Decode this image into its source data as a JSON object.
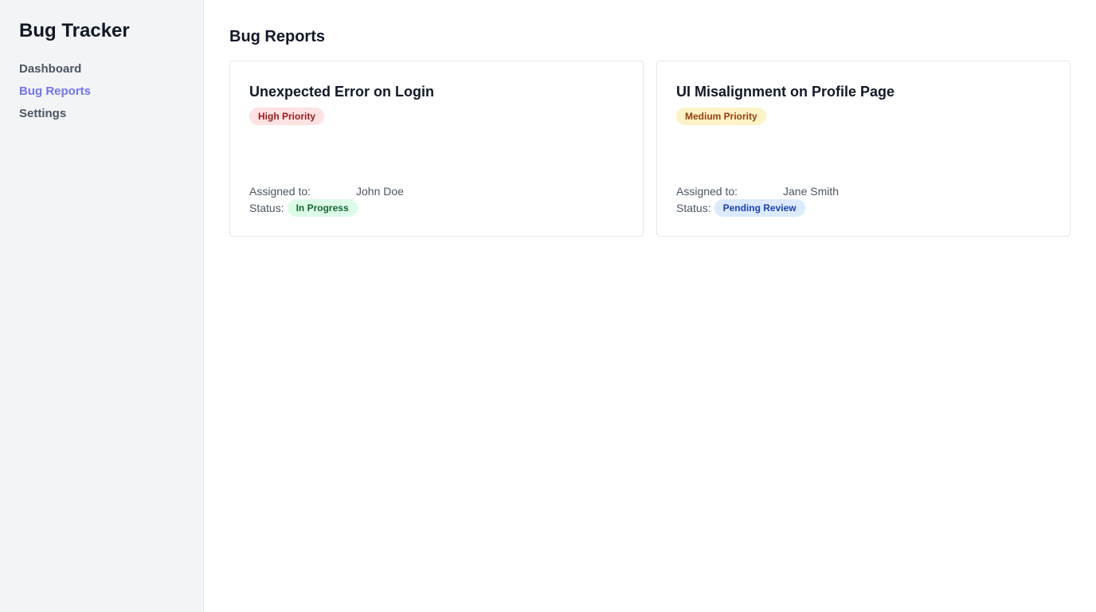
{
  "sidebar": {
    "title": "Bug Tracker",
    "items": [
      {
        "label": "Dashboard",
        "active": false
      },
      {
        "label": "Bug Reports",
        "active": true
      },
      {
        "label": "Settings",
        "active": false
      }
    ]
  },
  "main": {
    "title": "Bug Reports",
    "labels": {
      "assigned_to": "Assigned to:",
      "status": "Status:"
    },
    "bugs": [
      {
        "title": "Unexpected Error on Login",
        "priority": "High Priority",
        "assignee": "John Doe",
        "status": "In Progress"
      },
      {
        "title": "UI Misalignment on Profile Page",
        "priority": "Medium Priority",
        "assignee": "Jane Smith",
        "status": "Pending Review"
      }
    ]
  },
  "colors": {
    "accent": "#6366f1",
    "sidebar_bg": "#f3f4f6",
    "high_priority_bg": "#fee2e2",
    "medium_priority_bg": "#fef3c7",
    "in_progress_bg": "#dcfce7",
    "pending_review_bg": "#dbeafe"
  }
}
